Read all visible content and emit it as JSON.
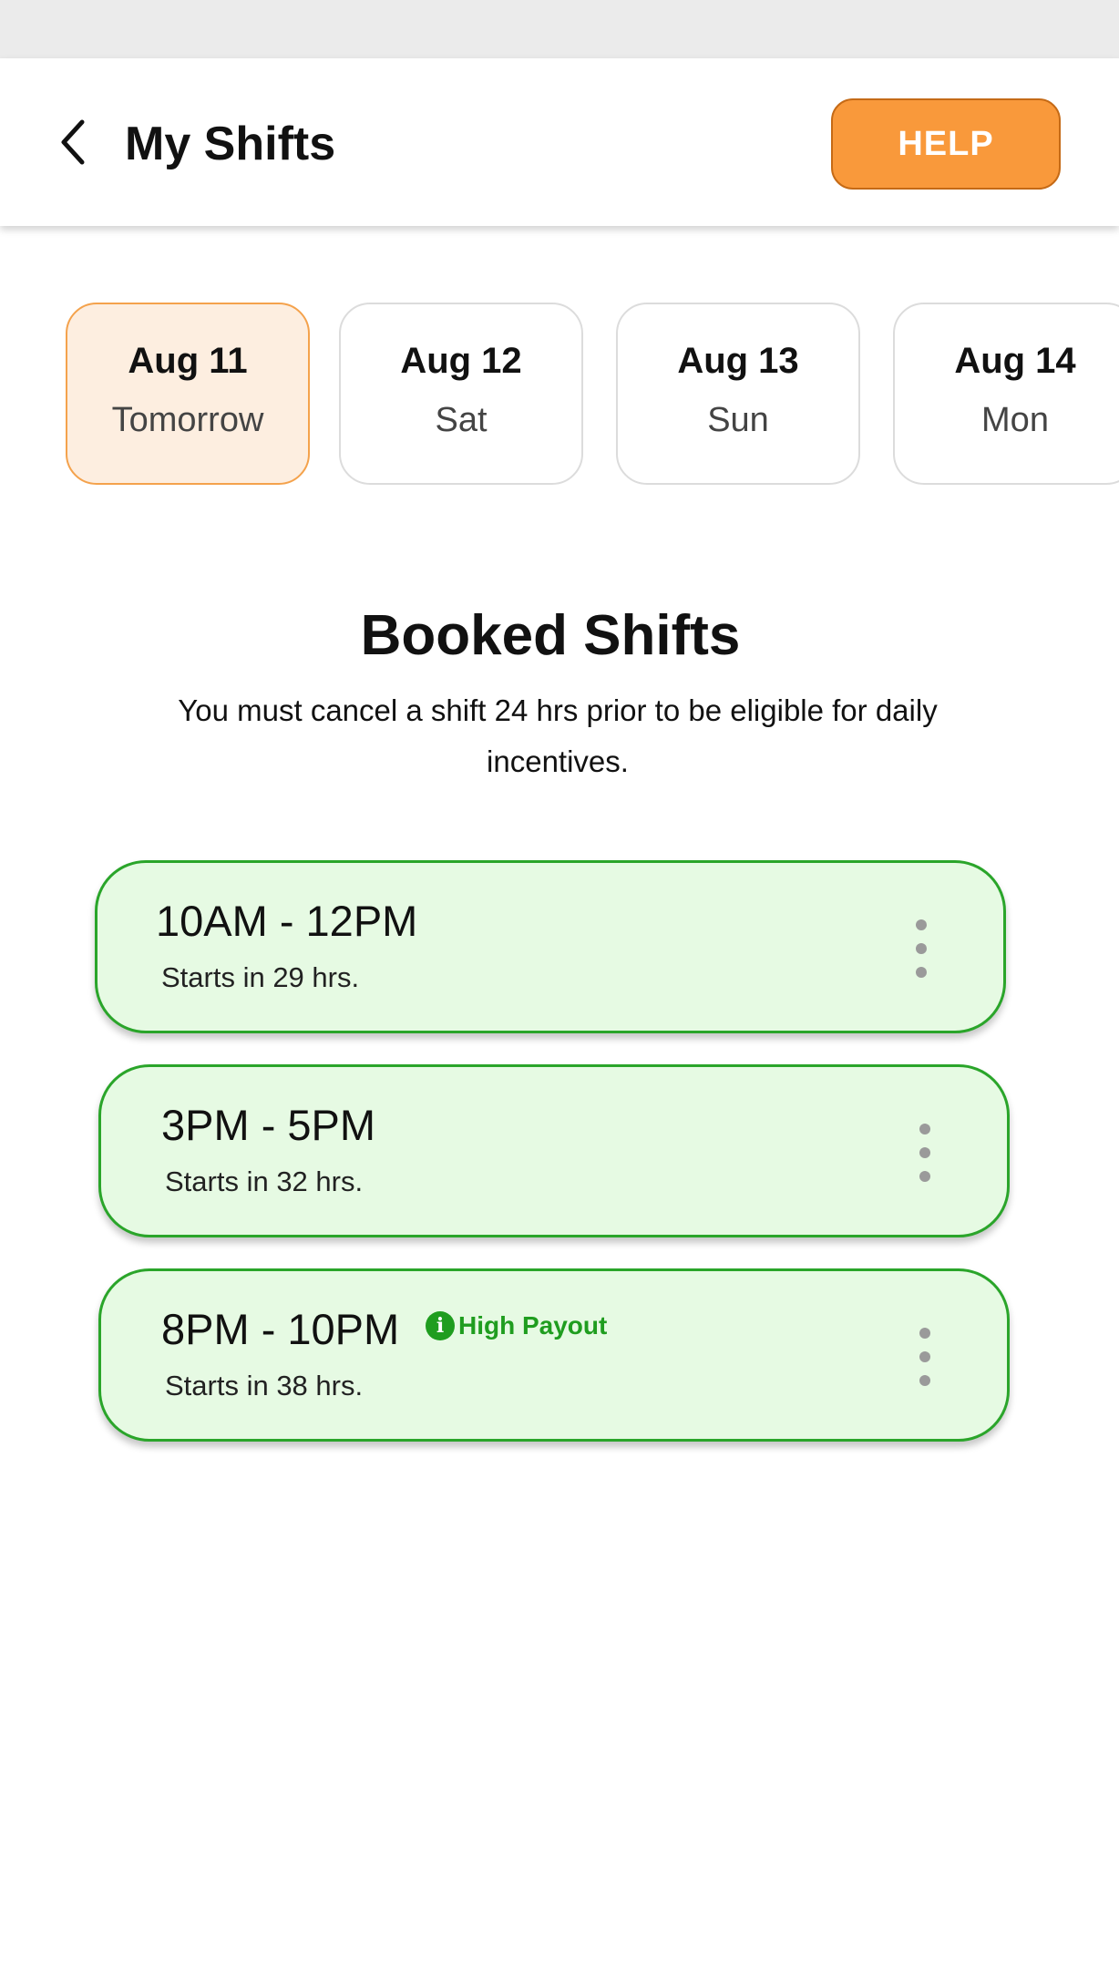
{
  "header": {
    "title": "My Shifts",
    "help_label": "HELP"
  },
  "dates": [
    {
      "date": "Aug 11",
      "day": "Tomorrow",
      "selected": true
    },
    {
      "date": "Aug 12",
      "day": "Sat",
      "selected": false
    },
    {
      "date": "Aug 13",
      "day": "Sun",
      "selected": false
    },
    {
      "date": "Aug 14",
      "day": "Mon",
      "selected": false
    }
  ],
  "booked": {
    "title": "Booked Shifts",
    "subtitle": "You must cancel a shift 24 hrs prior to be eligible for daily incentives."
  },
  "shifts": [
    {
      "time": "10AM - 12PM",
      "starts": "Starts in 29 hrs."
    },
    {
      "time": "3PM - 5PM",
      "starts": "Starts in 32 hrs."
    },
    {
      "time": "8PM - 10PM",
      "starts": "Starts in 38 hrs.",
      "badge": "High Payout"
    }
  ],
  "colors": {
    "accent": "#f9993b",
    "selected_bg": "#fdeee0",
    "shift_bg": "#e6fae3",
    "shift_border": "#2aa52a",
    "badge": "#1f9d1f"
  },
  "icons": {
    "back": "chevron-left-icon",
    "menu": "more-vertical-icon",
    "info": "info-icon"
  }
}
